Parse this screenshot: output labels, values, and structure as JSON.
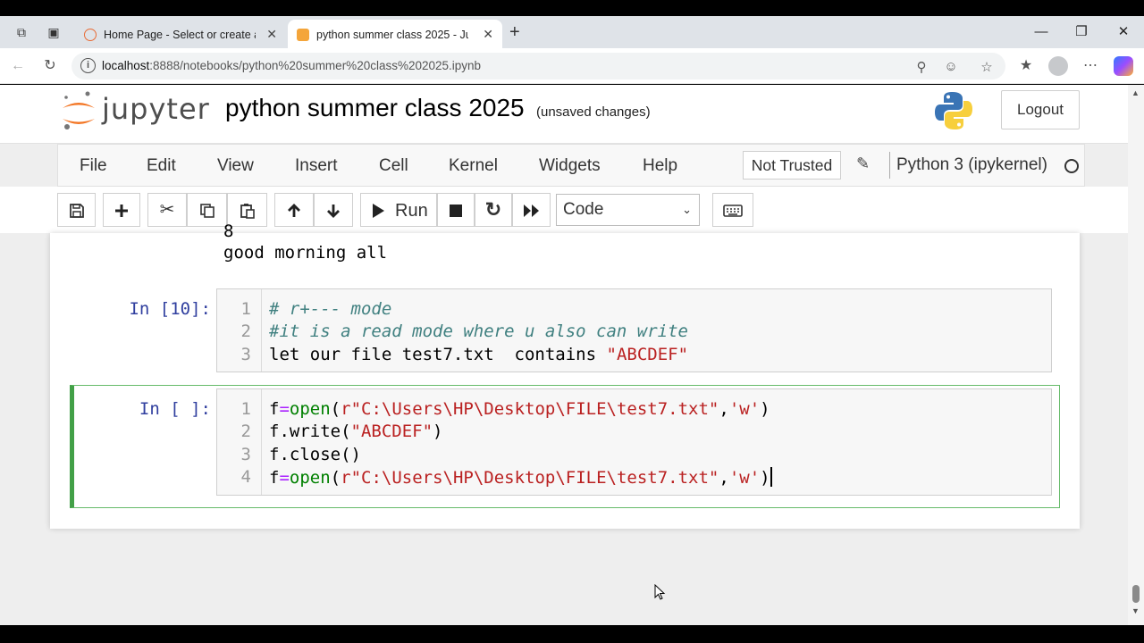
{
  "browser": {
    "tabs": [
      {
        "title": "Home Page - Select or create a notebook",
        "active": false
      },
      {
        "title": "python summer class 2025 - Jupyter Notebook",
        "active": true
      }
    ],
    "url_host": "localhost",
    "url_rest": ":8888/notebooks/python%20summer%20class%202025.ipynb"
  },
  "header": {
    "logo_text": "jupyter",
    "notebook_title": "python summer class 2025",
    "save_status": "(unsaved changes)",
    "logout_label": "Logout"
  },
  "menu": {
    "items": [
      "File",
      "Edit",
      "View",
      "Insert",
      "Cell",
      "Kernel",
      "Widgets",
      "Help"
    ],
    "trust_label": "Not Trusted",
    "kernel_name": "Python 3 (ipykernel)"
  },
  "toolbar": {
    "run_label": "Run",
    "cell_type": "Code"
  },
  "output": {
    "partial_line": "8",
    "line": "good morning all"
  },
  "cells": [
    {
      "prompt": "In [10]:",
      "lines": [
        {
          "num": "1",
          "text": "# r+--- mode"
        },
        {
          "num": "2",
          "text": "#it is a read mode where u also can write"
        },
        {
          "num": "3",
          "pre": "let our file test7.txt  contains ",
          "str": "\"ABCDEF\""
        }
      ]
    },
    {
      "prompt": "In [ ]:",
      "lines": [
        {
          "num": "1",
          "var": "f",
          "op": "=",
          "fn": "open",
          "p1": "(",
          "s1": "r\"C:\\Users\\HP\\Desktop\\FILE\\test7.txt\"",
          "comma": ",",
          "s2": "'w'",
          "p2": ")"
        },
        {
          "num": "2",
          "pre": "f.write(",
          "str": "\"ABCDEF\"",
          "post": ")"
        },
        {
          "num": "3",
          "text": "f.close()"
        },
        {
          "num": "4",
          "var": "f",
          "op": "=",
          "fn": "open",
          "p1": "(",
          "s1": "r\"C:\\Users\\HP\\Desktop\\FILE\\test7.txt\"",
          "comma": ",",
          "s2": "'w'",
          "p2": ")"
        }
      ]
    }
  ],
  "colors": {
    "prompt": "#303f9f",
    "selected_cell_border": "#42a047",
    "string": "#ba2121",
    "keyword": "#008000",
    "comment": "#408080"
  }
}
